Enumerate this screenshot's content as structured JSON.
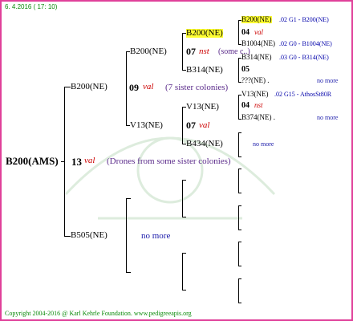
{
  "header": {
    "date": "6.  4.2016  ( 17: 10)"
  },
  "footer": {
    "copyright": "Copyright 2004-2016 @ Karl Kehrle Foundation.   www.pedigreeapis.org"
  },
  "root": {
    "label": "B200(AMS)",
    "num": "13",
    "qual": "val",
    "comment": "(Drones from some sister colonies)"
  },
  "gen1": {
    "top": {
      "label": "B200(NE)",
      "num": "09",
      "qual": "val",
      "comment": "(7 sister colonies)"
    },
    "bottom": {
      "label": "B505(NE)",
      "nomore": "no more"
    }
  },
  "gen2": {
    "a": {
      "label": "B200(NE)",
      "num": "07",
      "qual": "nst",
      "comment": "(some c..)"
    },
    "b": {
      "label": "V13(NE)",
      "num": "07",
      "qual": "val"
    }
  },
  "gen3": {
    "a": {
      "label": "B200(NE)",
      "num": "04",
      "qual": "val"
    },
    "b": {
      "label": "B314(NE)",
      "num": "05"
    },
    "c": {
      "label": "V13(NE)",
      "num": "04",
      "qual": "nst"
    },
    "d": {
      "label": "B434(NE)",
      "nomore": "no more"
    }
  },
  "gen4": {
    "a": {
      "label": "B200(NE)",
      "extra": ".02    G1 - B200(NE)"
    },
    "b": {
      "label": "B1004(NE)",
      "extra": ".02  G0 - B1004(NE)"
    },
    "c": {
      "label": "B314(NE)",
      "extra": ".03     G0 - B314(NE)"
    },
    "d": {
      "label": "???(NE) .",
      "nomore": "no more"
    },
    "e": {
      "label": "V13(NE)",
      "extra": ".02 G15 - AthosSt80R"
    },
    "f": {
      "label": "B374(NE) .",
      "nomore": "no more"
    }
  },
  "colors": {
    "frame": "#e0409a",
    "quality": "#cc0000",
    "comment": "#5a2a8a",
    "tail": "#0000aa",
    "highlight": "#ffff33",
    "footer": "#0a8a0a"
  }
}
